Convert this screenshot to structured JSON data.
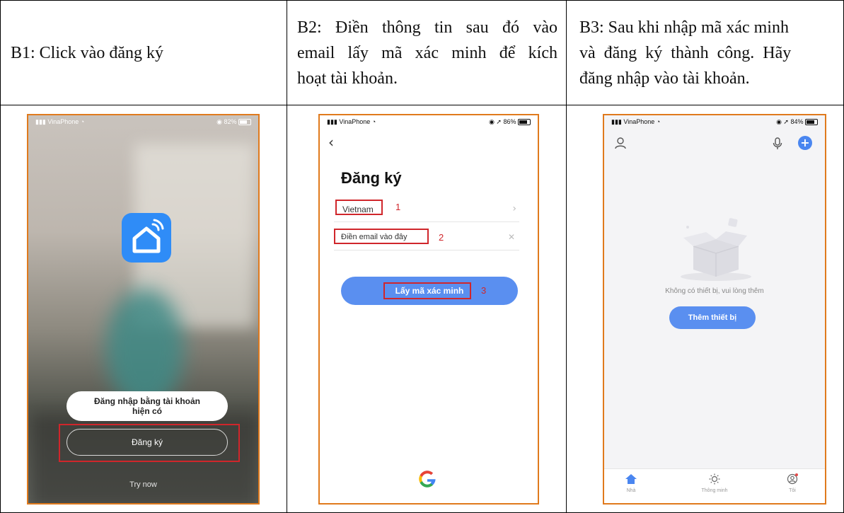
{
  "headers": {
    "b1": "B1: Click vào đăng ký",
    "b2": [
      "B2: Điền thông tin sau đó vào",
      "email lấy mã xác minh để kích",
      "hoạt tài khoản."
    ],
    "b3": [
      "B3: Sau khi nhập mã xác minh",
      "và đăng ký thành công. Hãy",
      "đăng nhập vào tài khoản."
    ]
  },
  "phone1": {
    "carrier": "VinaPhone",
    "battery": "82%",
    "login_label": "Đăng nhập bằng tài khoản hiện có",
    "register_label": "Đăng ký",
    "try_now": "Try now"
  },
  "phone2": {
    "carrier": "VinaPhone",
    "battery": "86%",
    "title": "Đăng ký",
    "country": "Vietnam",
    "email_placeholder": "Điền email vào đây",
    "code_button": "Lấy mã xác minh",
    "marker1": "1",
    "marker2": "2",
    "marker3": "3"
  },
  "phone3": {
    "carrier": "VinaPhone",
    "battery": "84%",
    "empty_text": "Không có thiết bị, vui lòng thêm",
    "add_button": "Thêm thiết bị",
    "nav": {
      "home": "Nhà",
      "smart": "Thông minh",
      "me": "Tôi"
    }
  },
  "colors": {
    "accent": "#5a8ff0",
    "highlight": "#d0262b",
    "phone_border": "#e07a1d",
    "app_icon": "#2f8cf7"
  }
}
